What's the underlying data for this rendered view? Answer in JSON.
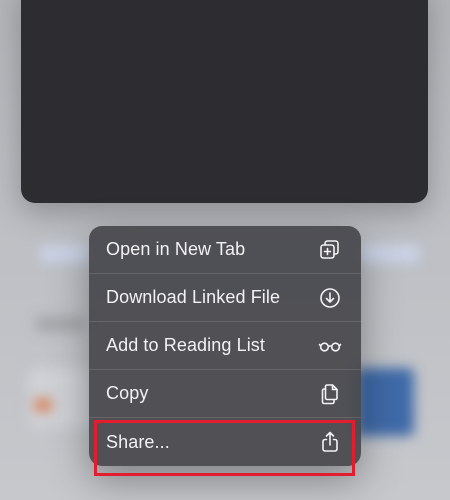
{
  "menu": {
    "items": [
      {
        "label": "Open in New Tab",
        "icon": "new-tab-icon"
      },
      {
        "label": "Download Linked File",
        "icon": "download-icon"
      },
      {
        "label": "Add to Reading List",
        "icon": "glasses-icon"
      },
      {
        "label": "Copy",
        "icon": "copy-icon"
      },
      {
        "label": "Share...",
        "icon": "share-icon"
      }
    ]
  },
  "colors": {
    "menu_background": "#48484e",
    "menu_text": "#f2f2f4",
    "preview_card": "#2d2c31",
    "highlight": "#e21d2d"
  }
}
